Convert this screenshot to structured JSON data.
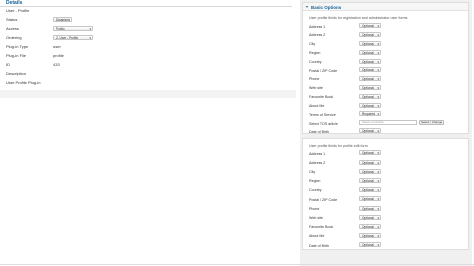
{
  "details": {
    "title": "Details",
    "plugin_name": "User - Profile",
    "fields": [
      {
        "label": "Status",
        "value": "Disabled",
        "type": "select"
      },
      {
        "label": "Access",
        "value": "Public",
        "type": "select"
      },
      {
        "label": "Ordering",
        "value": "2. User - Profile",
        "type": "select"
      },
      {
        "label": "Plug-in Type",
        "value": "user",
        "type": "text"
      },
      {
        "label": "Plug-in File",
        "value": "profile",
        "type": "text"
      },
      {
        "label": "ID",
        "value": "433",
        "type": "text"
      },
      {
        "label": "Description",
        "value": "",
        "type": "text"
      }
    ],
    "footer_text": "User Profile Plug-in"
  },
  "basic_options": {
    "title": "Basic Options",
    "toggle": "▾",
    "registration": {
      "description": "User profile fields for registration and administrator user forms",
      "fields": [
        {
          "label": "Address 1",
          "value": "Optional"
        },
        {
          "label": "Address 2",
          "value": "Optional"
        },
        {
          "label": "City",
          "value": "Optional"
        },
        {
          "label": "Region",
          "value": "Optional"
        },
        {
          "label": "Country",
          "value": "Optional"
        },
        {
          "label": "Postal / ZIP Code",
          "value": "Optional"
        },
        {
          "label": "Phone",
          "value": "Optional"
        },
        {
          "label": "Web site",
          "value": "Optional"
        },
        {
          "label": "Favourite Book",
          "value": "Optional"
        },
        {
          "label": "About Me",
          "value": "Optional"
        },
        {
          "label": "Terms of Service",
          "value": "Required"
        }
      ],
      "tos_article": {
        "label": "Select TOS article",
        "placeholder": "Select an Article",
        "button": "Select / Change"
      },
      "last_field": {
        "label": "Date of Birth",
        "value": "Optional"
      }
    },
    "profile": {
      "description": "User profile fields for profile edit form",
      "fields": [
        {
          "label": "Address 1",
          "value": "Optional"
        },
        {
          "label": "Address 2",
          "value": "Optional"
        },
        {
          "label": "City",
          "value": "Optional"
        },
        {
          "label": "Region",
          "value": "Optional"
        },
        {
          "label": "Country",
          "value": "Optional"
        },
        {
          "label": "Postal / ZIP Code",
          "value": "Optional"
        },
        {
          "label": "Phone",
          "value": "Optional"
        },
        {
          "label": "Web site",
          "value": "Optional"
        },
        {
          "label": "Favourite Book",
          "value": "Optional"
        },
        {
          "label": "About Me",
          "value": "Optional"
        },
        {
          "label": "Date of Birth",
          "value": "Optional"
        }
      ]
    }
  }
}
